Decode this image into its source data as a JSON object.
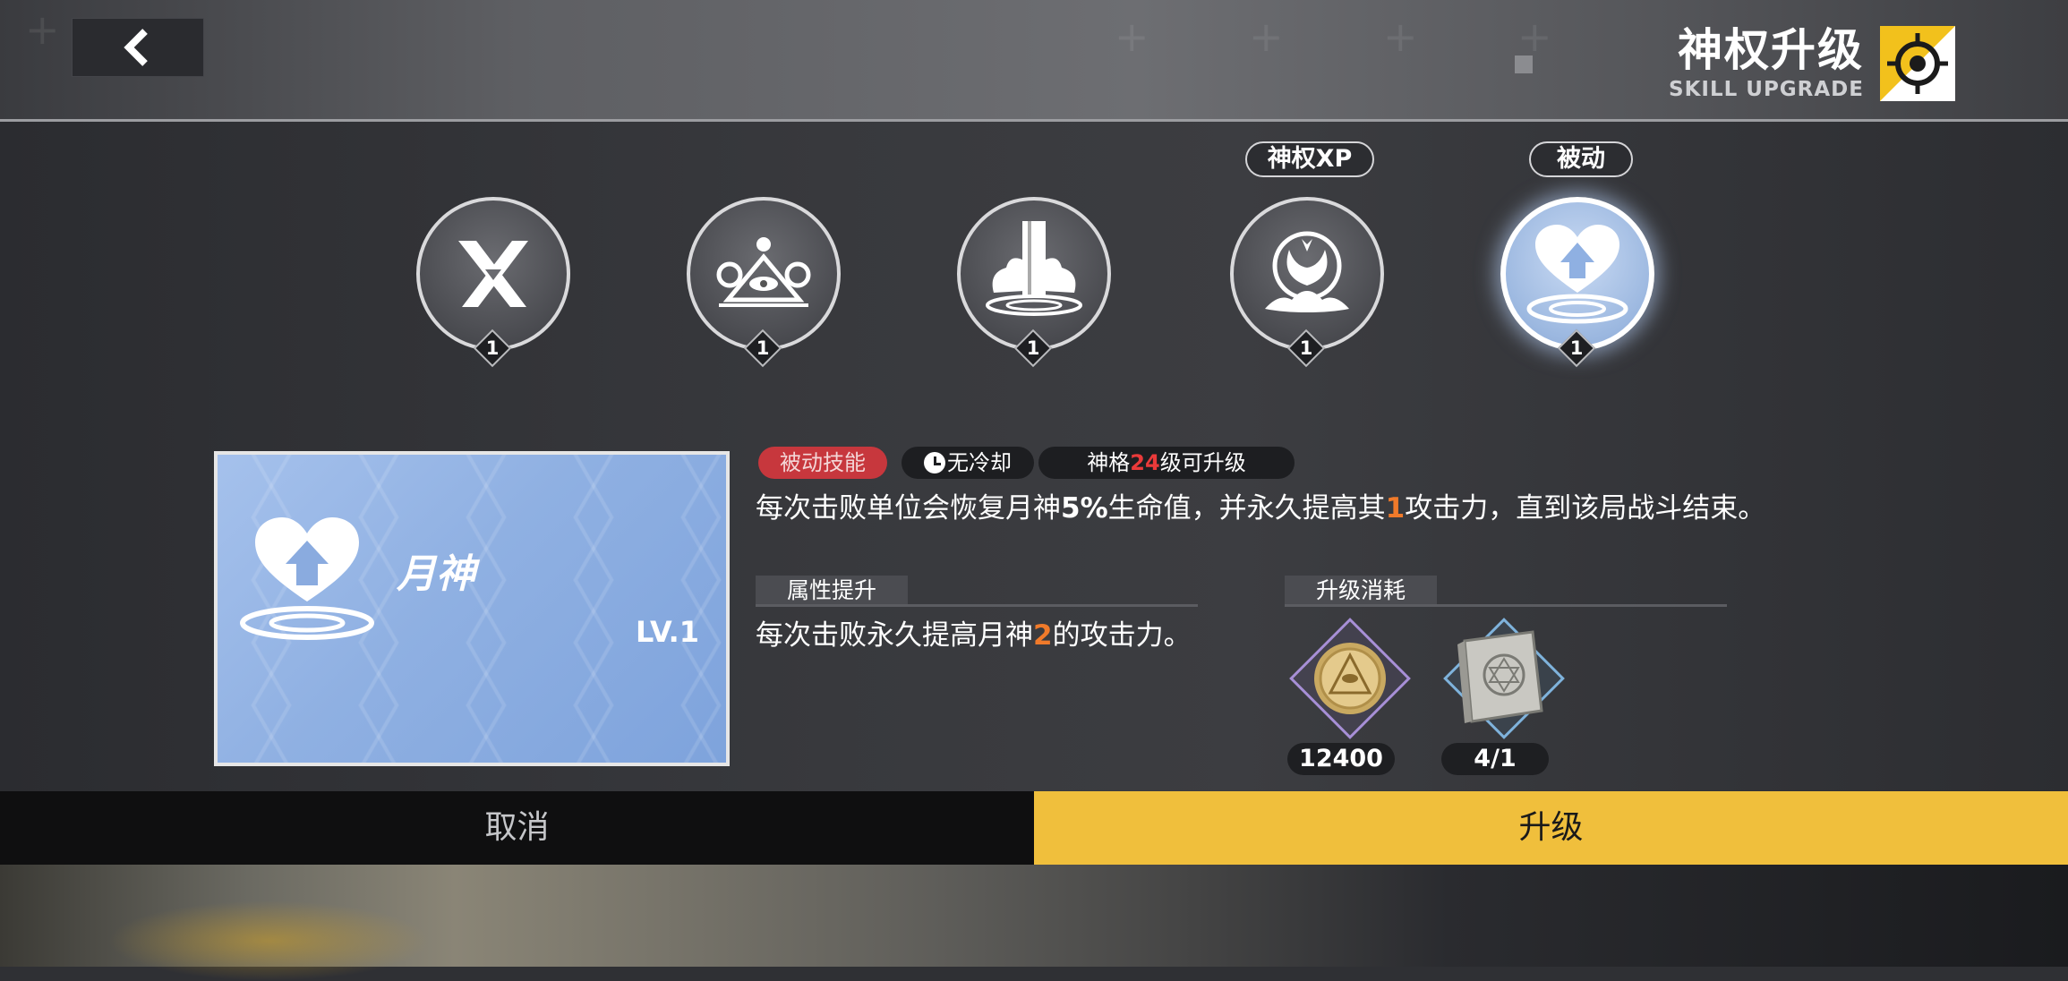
{
  "header": {
    "title": "神权升级",
    "subtitle": "SKILL UPGRADE"
  },
  "skills": [
    {
      "name": "skill-x",
      "level": "1",
      "icon": "crossed-blades-icon"
    },
    {
      "name": "skill-eye-triangle",
      "level": "1",
      "icon": "eye-triangle-icon"
    },
    {
      "name": "skill-pillar",
      "level": "1",
      "icon": "light-pillar-icon"
    },
    {
      "name": "skill-phoenix",
      "level": "1",
      "icon": "phoenix-orb-icon",
      "tag": "神权XP"
    },
    {
      "name": "skill-heart",
      "level": "1",
      "icon": "heart-up-icon",
      "tag": "被动",
      "selected": true
    }
  ],
  "card": {
    "name": "月神",
    "level": "LV.1",
    "icon": "heart-up-icon"
  },
  "tags": {
    "passive": "被动技能",
    "cooldown": "无冷却",
    "level_prefix": "神格",
    "level_value": "24",
    "level_suffix": "级可升级"
  },
  "description": {
    "p1": "每次击败单位会恢复月神",
    "v1": "5%",
    "p2": "生命值，并永久提高其",
    "v2": "1",
    "p3": "攻击力，直到该局战斗结束。"
  },
  "attribute": {
    "header": "属性提升",
    "p1": "每次击败永久提高月神",
    "v1": "2",
    "p2": "的攻击力。"
  },
  "cost": {
    "header": "升级消耗",
    "items": [
      {
        "icon": "gold-coin-icon",
        "amount": "12400"
      },
      {
        "icon": "tome-book-icon",
        "amount": "4/1"
      }
    ]
  },
  "buttons": {
    "cancel": "取消",
    "upgrade": "升级"
  },
  "colors": {
    "accent_yellow": "#f0bf3c",
    "passive_red": "#c7373d",
    "highlight_orange": "#f07a2a",
    "highlight_red": "#ea3a3a"
  }
}
